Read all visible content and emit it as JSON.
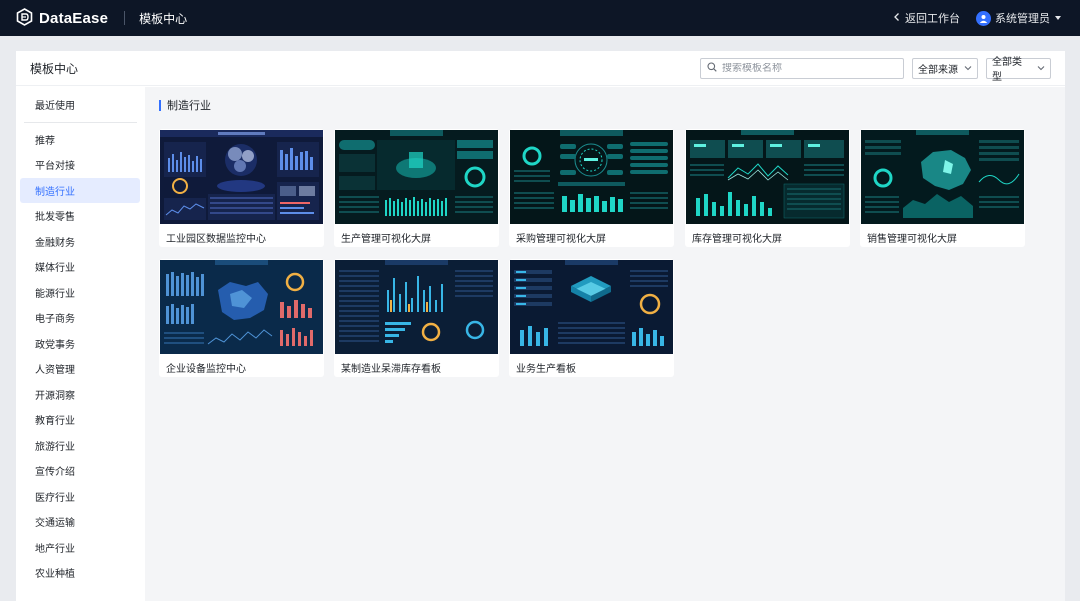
{
  "topbar": {
    "brand": "DataEase",
    "title": "模板中心",
    "back_label": "返回工作台",
    "user_label": "系统管理员"
  },
  "panel": {
    "title": "模板中心",
    "search_placeholder": "搜索模板名称",
    "source_select": "全部来源",
    "type_select": "全部类型"
  },
  "sidebar": {
    "recent": "最近使用",
    "items": [
      "推荐",
      "平台对接",
      "制造行业",
      "批发零售",
      "金融财务",
      "媒体行业",
      "能源行业",
      "电子商务",
      "政党事务",
      "人资管理",
      "开源洞察",
      "教育行业",
      "旅游行业",
      "宣传介绍",
      "医疗行业",
      "交通运输",
      "地产行业",
      "农业种植"
    ],
    "active": "制造行业"
  },
  "section": {
    "title": "制造行业"
  },
  "templates": [
    {
      "name": "工业园区数据监控中心"
    },
    {
      "name": "生产管理可视化大屏"
    },
    {
      "name": "采购管理可视化大屏"
    },
    {
      "name": "库存管理可视化大屏"
    },
    {
      "name": "销售管理可视化大屏"
    },
    {
      "name": "企业设备监控中心"
    },
    {
      "name": "某制造业呆滞库存看板"
    },
    {
      "name": "业务生产看板"
    }
  ],
  "colors": {
    "topbar_bg": "#0d1626",
    "accent": "#3370ff",
    "active_bg": "#e5ecff",
    "content_bg": "#f4f5f7"
  },
  "icons": {
    "logo": "dataease-logo-icon",
    "back": "chevron-left-icon",
    "user": "user-avatar-icon",
    "caret": "caret-down-icon",
    "search": "search-icon",
    "select": "chevron-down-icon"
  }
}
